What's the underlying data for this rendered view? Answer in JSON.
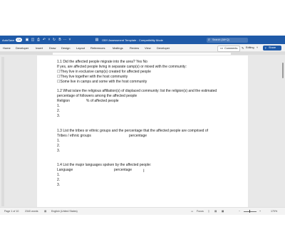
{
  "titlebar": {
    "autosave": "AutoSave",
    "toggle": "Off",
    "title": "OBY Assessment Template - Compatibility Mode",
    "search_placeholder": "Search (Alt+Q)",
    "colors": {
      "bar": "#1f5aa8"
    }
  },
  "ribbon": {
    "tabs": [
      "Home",
      "Developer",
      "Insert",
      "Draw",
      "Design",
      "Layout",
      "References",
      "Mailings",
      "Review",
      "View",
      "Developer"
    ],
    "comments": "Comments",
    "editing": "Editing",
    "share": "Share"
  },
  "document": {
    "q11": "1.1 Did the affected people migrate into the area?   Yes No",
    "q11_sub": "If yes, are affected people living in separate camp(s) or mixed with the community:",
    "q11_opts": [
      "They live in exclusive camp(s) created for affected people",
      "They live together with the host community",
      "Some live in camps and some with the host community"
    ],
    "q12_a": "1.2 What is/are the religious affiliation(s) of displaced community: list the religion(s) and the estimated",
    "q12_b": "percentage of followers among the affected people",
    "q12_col1": "Religion",
    "q12_col2": "% of affected people",
    "q13_a": "1.3 List the tribes or ethnic groups and the percentage that the affected people are comprised of",
    "q13_col1": "Tribes / ethnic groups",
    "q13_col2": "percentage",
    "q14_a": "1.4 List the major languages spoken by the affected people:",
    "q14_col1": "Language",
    "q14_col2": "percentage",
    "n1": "1.",
    "n2": "2.",
    "n3": "3."
  },
  "status": {
    "page": "Page 1 of 10",
    "words": "2340 words",
    "language": "English (United States)",
    "focus": "Focus",
    "zoom": "170%"
  }
}
